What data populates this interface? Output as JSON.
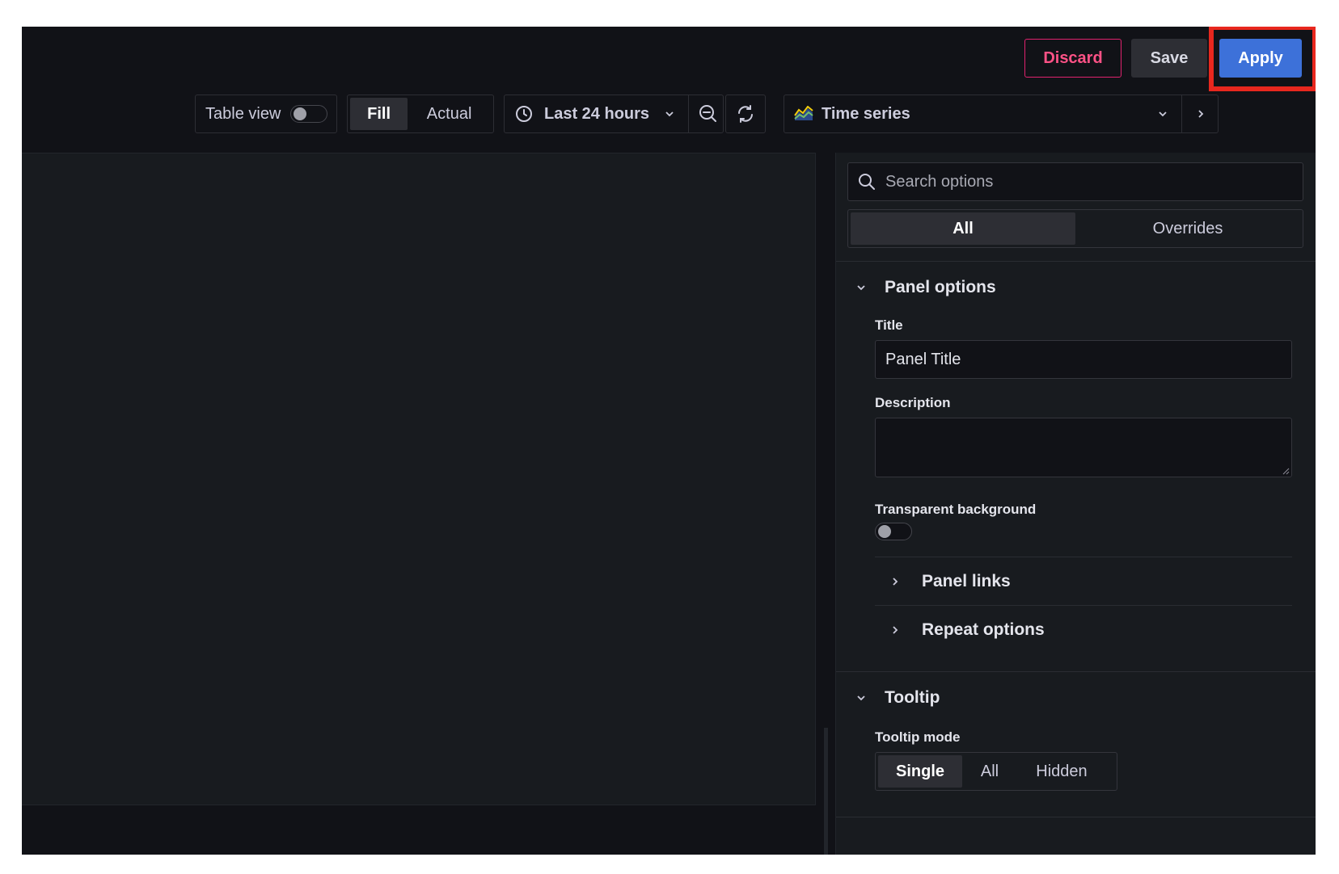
{
  "toolbar": {
    "discard_label": "Discard",
    "save_label": "Save",
    "apply_label": "Apply",
    "table_view_label": "Table view",
    "table_view_on": false,
    "fill_label": "Fill",
    "actual_label": "Actual",
    "time_range_label": "Last 24 hours",
    "visualization_label": "Time series"
  },
  "options": {
    "search_placeholder": "Search options",
    "tabs": [
      {
        "label": "All",
        "active": true
      },
      {
        "label": "Overrides",
        "active": false
      }
    ],
    "panel_options": {
      "heading": "Panel options",
      "title_label": "Title",
      "title_value": "Panel Title",
      "description_label": "Description",
      "description_value": "",
      "transparent_label": "Transparent background",
      "transparent_on": false,
      "panel_links_label": "Panel links",
      "repeat_options_label": "Repeat options"
    },
    "tooltip": {
      "heading": "Tooltip",
      "mode_label": "Tooltip mode",
      "modes": [
        {
          "label": "Single",
          "active": true
        },
        {
          "label": "All",
          "active": false
        },
        {
          "label": "Hidden",
          "active": false
        }
      ]
    }
  },
  "colors": {
    "background": "#111217",
    "panel": "#181b1f",
    "apply_blue": "#3d71d9",
    "discard_pink": "#ff5286",
    "highlight_red": "#e8271e"
  },
  "icons": {
    "clock": "clock-icon",
    "zoom_out": "zoom-out-icon",
    "refresh": "refresh-icon",
    "visualization": "time-series-icon",
    "search": "search-icon"
  }
}
